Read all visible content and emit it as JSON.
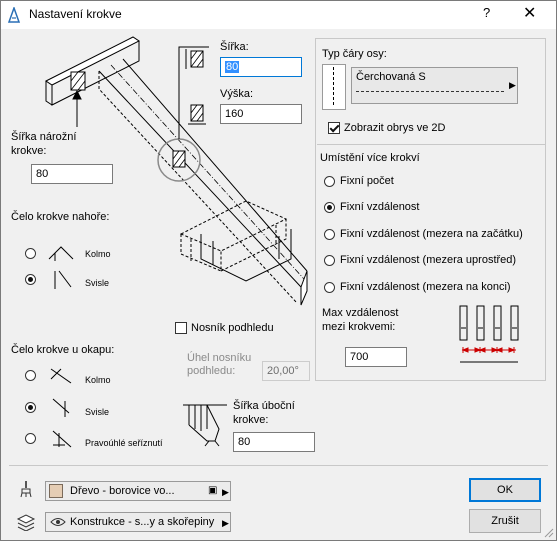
{
  "window": {
    "title": "Nastavení krokve",
    "help_label": "?",
    "close_label": "✕"
  },
  "dimensions": {
    "width_label": "Šířka:",
    "width_value": "80",
    "height_label": "Výška:",
    "height_value": "160",
    "ridge_width_label_1": "Šířka nárožní",
    "ridge_width_label_2": "krokve:",
    "ridge_width_value": "80"
  },
  "top_end": {
    "title": "Čelo krokve nahoře:",
    "options": [
      {
        "label": "Kolmo",
        "selected": false
      },
      {
        "label": "Svisle",
        "selected": true
      }
    ]
  },
  "eave_end": {
    "title": "Čelo krokve u okapu:",
    "options": [
      {
        "label": "Kolmo",
        "selected": false
      },
      {
        "label": "Svisle",
        "selected": true
      },
      {
        "label": "Pravoúhlé seříznutí",
        "selected": false
      }
    ]
  },
  "soffit": {
    "checkbox_label": "Nosník podhledu",
    "checked": false,
    "angle_label_1": "Úhel nosníku",
    "angle_label_2": "podhledu:",
    "angle_value": "20,00°"
  },
  "diagonal": {
    "label_1": "Šířka úboční",
    "label_2": "krokve:",
    "value": "80"
  },
  "axis_line": {
    "title": "Typ čáry osy:",
    "value": "Čerchovaná S",
    "show_outline_label": "Zobrazit obrys ve 2D",
    "show_outline_checked": true
  },
  "placement": {
    "title": "Umístění více krokví",
    "options": [
      {
        "label": "Fixní počet",
        "selected": false
      },
      {
        "label": "Fixní vzdálenost",
        "selected": true
      },
      {
        "label": "Fixní vzdálenost (mezera na začátku)",
        "selected": false
      },
      {
        "label": "Fixní vzdálenost (mezera uprostřed)",
        "selected": false
      },
      {
        "label": "Fixní vzdálenost (mezera na konci)",
        "selected": false
      }
    ],
    "max_distance_label_1": "Max vzdálenost",
    "max_distance_label_2": "mezi krokvemi:",
    "max_distance_value": "700"
  },
  "bottom": {
    "material_value": "Dřevo - borovice vo...",
    "layer_value": "Konstrukce - s...y a skořepiny"
  },
  "buttons": {
    "ok": "OK",
    "cancel": "Zrušit"
  },
  "colors": {
    "accent": "#0078d7",
    "selection": "#3390ff",
    "material_swatch": "#e5cdb4",
    "arrow_red": "#cc0000"
  }
}
